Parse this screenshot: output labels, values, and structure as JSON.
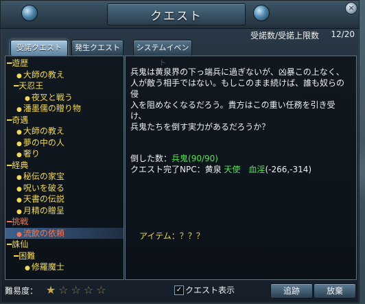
{
  "window": {
    "title": "クエスト",
    "close_glyph": "×"
  },
  "header": {
    "limit_label": "受諾数/受諾上限数",
    "count": "12/20"
  },
  "tabs": [
    {
      "label": "受諾クエスト",
      "active": true
    },
    {
      "label": "発生クエスト",
      "active": false
    },
    {
      "label": "システムイベント",
      "active": false
    }
  ],
  "tree": [
    {
      "label": "遊歴",
      "type": "cat"
    },
    {
      "label": "大師の教え",
      "type": "leaf",
      "depth": 1
    },
    {
      "label": "天忍王",
      "type": "subcat"
    },
    {
      "label": "夜叉と戦う",
      "type": "leaf",
      "depth": 2
    },
    {
      "label": "潘墨儒の贈り物",
      "type": "leaf",
      "depth": 1
    },
    {
      "label": "奇遇",
      "type": "cat"
    },
    {
      "label": "大師の教え",
      "type": "leaf",
      "depth": 1
    },
    {
      "label": "夢の中の人",
      "type": "leaf",
      "depth": 1
    },
    {
      "label": "奢り",
      "type": "leaf",
      "depth": 1
    },
    {
      "label": "経典",
      "type": "cat"
    },
    {
      "label": "秘伝の家宝",
      "type": "leaf",
      "depth": 1
    },
    {
      "label": "呪いを破る",
      "type": "leaf",
      "depth": 1
    },
    {
      "label": "天書の伝説",
      "type": "leaf",
      "depth": 1
    },
    {
      "label": "月精の贈呈",
      "type": "leaf",
      "depth": 1
    },
    {
      "label": "挑戦",
      "type": "cat",
      "color": "red"
    },
    {
      "label": "流飲の依頼",
      "type": "leaf",
      "depth": 1,
      "selected": true
    },
    {
      "label": "誅仙",
      "type": "cat"
    },
    {
      "label": "困難",
      "type": "subcat"
    },
    {
      "label": "修羅魔士",
      "type": "leaf",
      "depth": 2
    }
  ],
  "details": {
    "description": "兵鬼は黄泉界の下っ端兵に過ぎないが、凶暴この上なく、\n人が敵う相手ではない。もしこのまま続けば、誰も奴らの侵\n入を阻めなくなるだろう。貴方はこの重い任務を引き受け、\n兵鬼たちを倒す実力があるだろうか？",
    "defeated_label": "倒した数：",
    "defeated_target": "兵鬼",
    "defeated_count": "(90/90)",
    "npc_label": "クエスト完了NPC：黄泉 ",
    "npc_name": "天使　血淫",
    "npc_coords": "(-266,-314)",
    "item_label": "アイテム：？？？"
  },
  "footer": {
    "difficulty_label": "難易度：",
    "stars": [
      {
        "glyph": "★",
        "filled": true
      },
      {
        "glyph": "☆",
        "filled": false
      },
      {
        "glyph": "☆",
        "filled": false
      },
      {
        "glyph": "☆",
        "filled": false
      },
      {
        "glyph": "☆",
        "filled": false
      }
    ],
    "show_quest_label": "クエスト表示",
    "show_quest_checked": true,
    "check_glyph": "✓",
    "track_button": "追跡",
    "abandon_button": "放棄"
  },
  "colors": {
    "accent_yellow": "#f2d95a",
    "accent_red": "#f07858",
    "accent_green": "#58e058"
  }
}
